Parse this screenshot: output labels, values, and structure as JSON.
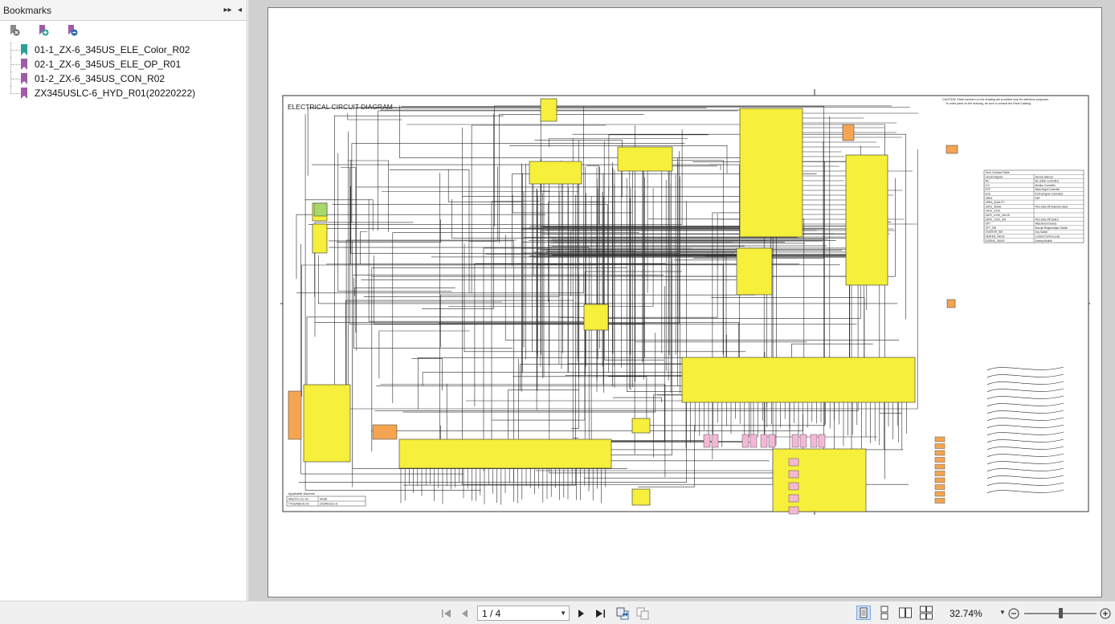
{
  "sidebar": {
    "title": "Bookmarks",
    "header_controls": [
      "expand-icon",
      "collapse-icon"
    ],
    "toolbar_icons": [
      "delete-bookmark-icon",
      "add-bookmark-icon",
      "add-child-bookmark-icon"
    ],
    "items": [
      {
        "label": "01-1_ZX-6_345US_ELE_Color_R02",
        "flag_color": "#2aa198",
        "selected": true
      },
      {
        "label": "02-1_ZX-6_345US_ELE_OP_R01",
        "flag_color": "#a05aa8"
      },
      {
        "label": "01-2_ZX-6_345US_CON_R02",
        "flag_color": "#a05aa8"
      },
      {
        "label": "ZX345USLC-6_HYD_R01(20220222)",
        "flag_color": "#a05aa8"
      }
    ]
  },
  "document": {
    "title": "ELECTRICAL CIRCUIT DIAGRAM",
    "caution_line1": "CAUTION: Parts numbers on the drawing are provided only for reference purposes.",
    "caution_line2": "To order parts on the drawing, be sure to consult the Parts Catalog.",
    "term_table": {
      "header": [
        "Term Contrast Table",
        ""
      ],
      "rows": [
        [
          "Circuit Diagram",
          "Service Manual"
        ],
        [
          "MC",
          "MC (Main Controller)"
        ],
        [
          "ICX",
          "Monitor Controller"
        ],
        [
          "ECF",
          "Wiper/Light Controller"
        ],
        [
          "ECU",
          "ECM (Engine Controller)"
        ],
        [
          "UREA",
          "DEF"
        ],
        [
          "UREA_QUALITY",
          ""
        ],
        [
          "GATE_VALVE",
          "Pilot Shut-Off Solenoid Valve"
        ],
        [
          "GATE_LOCK",
          ""
        ],
        [
          "GATE_LOCK_VALVE",
          ""
        ],
        [
          "GATE_LOCK_SW",
          "Pilot Shut-Off Switch"
        ],
        [
          "OPT",
          "Attachment Device"
        ],
        [
          "OPT_SW",
          "Manual Regeneration Switch"
        ],
        [
          "STARTER_SW",
          "Key Switch"
        ],
        [
          "HEATER_VALVE",
          "Coolant Control Level"
        ],
        [
          "DOSING_VALVE",
          "Dosing Module"
        ]
      ]
    },
    "applicable": {
      "title": "Applicable Machine",
      "headers": [
        "Attach to vol. No.",
        "Model"
      ],
      "row": [
        "TTOGA6B-01-00",
        "ZX345USLC-6"
      ]
    }
  },
  "bottom_toolbar": {
    "nav_icons": [
      "first-page-icon",
      "previous-page-icon",
      "next-page-icon",
      "last-page-icon",
      "previous-view-icon",
      "next-view-icon"
    ],
    "page_display": "1 / 4",
    "view_icons": [
      "single-page-icon",
      "continuous-icon",
      "facing-icon",
      "continuous-facing-icon"
    ],
    "zoom": "32.74%",
    "zoom_level_fraction": 0.3274,
    "colors": {
      "accent": "#2b6cb0",
      "yellow": "#f6ef3b",
      "pink": "#f4b8d6",
      "orange": "#f5a552"
    }
  }
}
